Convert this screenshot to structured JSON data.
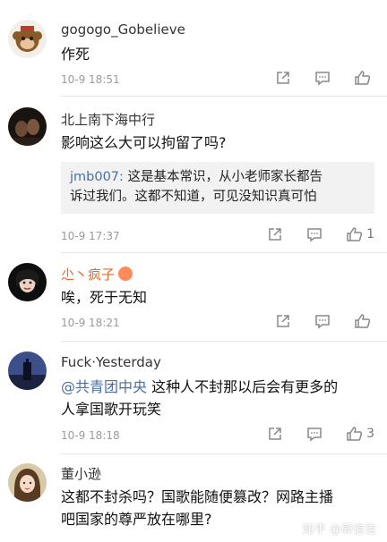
{
  "comments": [
    {
      "username": "gogogo_Gobelieve",
      "text": "作死",
      "time": "10-9 18:51",
      "likes": ""
    },
    {
      "username": "北上南下海中行",
      "text": "影响这么大可以拘留了吗?",
      "quote_user": "jmb007:",
      "quote_line1": " 这是基本常识，从小老师家长都告",
      "quote_line2": "诉过我们。这都不知道，可见没知识真可怕",
      "time": "10-9 17:37",
      "likes": "1"
    },
    {
      "username": "尐丶疯子",
      "text": "唉，死于无知",
      "time": "10-9 18:21",
      "likes": ""
    },
    {
      "username": "Fuck·Yesterday",
      "mention": "@共青团中央",
      "text_line1": " 这种人不封那以后会有更多的",
      "text_line2": "人拿国歌开玩笑",
      "time": "10-9 18:18",
      "likes": "3"
    },
    {
      "username": "董小逊",
      "text_line1": "这都不封杀吗？国歌能随便篡改？网路主播",
      "text_line2": "吧国家的尊严放在哪里?",
      "time": "",
      "likes": ""
    }
  ],
  "watermark": "知乎 @郭信信",
  "colors": {
    "link": "#4a6fa5",
    "meta": "#9a9a9a",
    "divider": "#e5e5e5",
    "quote_bg": "#f2f2f2"
  },
  "icons": [
    "share-icon",
    "comment-icon",
    "like-icon"
  ]
}
